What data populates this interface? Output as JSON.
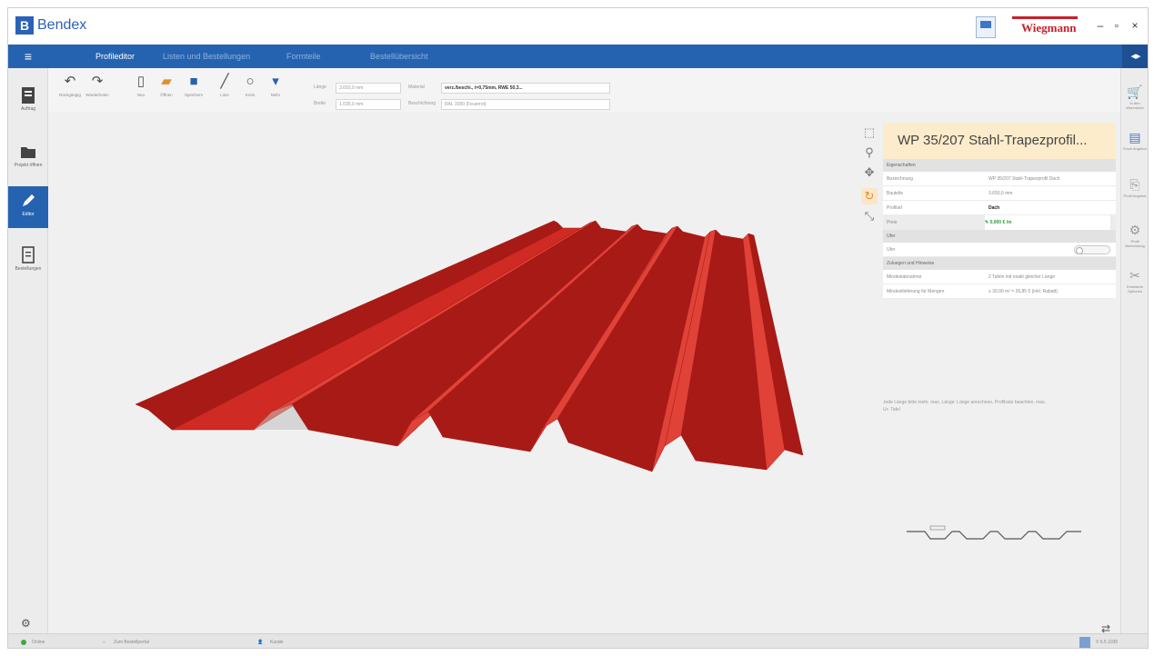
{
  "window": {
    "app_name": "Bendex",
    "logo_letter": "B",
    "brand": "Wiegmann",
    "minimize": "–",
    "maximize": "▫",
    "close": "×"
  },
  "menu": {
    "hamburger": "≡",
    "tabs": [
      "Profileditor",
      "Listen und Bestellungen",
      "Formteile",
      "Bestellübersicht"
    ],
    "collapse": "◂▸"
  },
  "left_sidebar": {
    "items": [
      "Auftrag",
      "Projekt öffnen",
      "Editor",
      "Bestellungen"
    ],
    "active": "Editor"
  },
  "toolbar": {
    "tools": [
      "Rückgängig",
      "Wiederholen",
      "Neu",
      "Öffnen",
      "Speichern",
      "Linie",
      "Kreis",
      "Mehr"
    ],
    "length_label": "Länge",
    "length_value": "3.650,0 mm",
    "width_label": "Breite",
    "width_value": "1.035,0 mm",
    "material_label": "Material",
    "material_value": "verz./beschi., t=0,75mm, RWE 50,3...",
    "color_label": "Beschichtung",
    "color_value": "RAL 3000 (Feuerrot)"
  },
  "viewport": {
    "colors": {
      "face": "#d02a24",
      "light": "#e04238",
      "dark": "#a71a16",
      "floor": "#f0f0f0"
    },
    "nav_icons": [
      "zoom-region-icon",
      "zoom-icon",
      "pan-icon",
      "rotate-icon",
      "fit-icon"
    ]
  },
  "panel": {
    "title": "WP 35/207 Stahl-Trapezprofil...",
    "section1": "Eigenschaften",
    "rows": [
      {
        "key": "Bezeichnung",
        "value": "WP 35/207 Stahl-Trapezprofil Dach"
      },
      {
        "key": "Bauteile",
        "value": "3.650,0 mm"
      },
      {
        "key": "Profilart",
        "value": "Dach"
      },
      {
        "key": "Preis",
        "value": "✎ 0,000 € /m"
      }
    ],
    "section2": "Ufer",
    "toggle_label": "Ufer",
    "section3": "Zuluegen und Hinweise",
    "rows3": [
      {
        "key": "Mindestabnahme",
        "value": "2 Tafeln mit exakt gleicher Länge"
      },
      {
        "key": "Mindestlieferung für Mengen",
        "value": "≥ 30,00 m² = 26,85 € (inkl. Rabatt)"
      }
    ],
    "note": "Jede Länge bitte mehr. max. Länge: Länge anrechnen, Profilsatz beachten. max. Ur- Tafel"
  },
  "right_sidebar": {
    "items": [
      "In den Warenkorb",
      "Excel Angebot",
      "Profil Angebot",
      "Profil Berechnung",
      "Erweiterte Optionen"
    ]
  },
  "statusbar": {
    "status": "Online",
    "home": "Zum Bestellportal",
    "user": "Kunde",
    "version": "V 6.5.1035"
  }
}
